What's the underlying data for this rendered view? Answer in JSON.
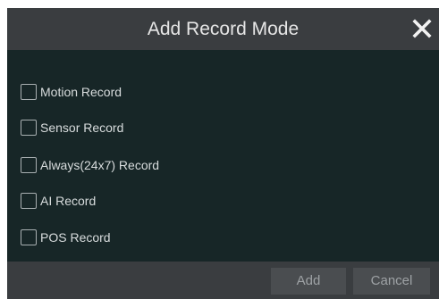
{
  "dialog": {
    "title": "Add Record Mode",
    "close_icon": "close-icon",
    "options": [
      {
        "label": "Motion Record",
        "checked": false
      },
      {
        "label": "Sensor Record",
        "checked": false
      },
      {
        "label": "Always(24x7) Record",
        "checked": false
      },
      {
        "label": "AI Record",
        "checked": false
      },
      {
        "label": "POS Record",
        "checked": false
      }
    ],
    "buttons": {
      "add_label": "Add",
      "cancel_label": "Cancel"
    }
  },
  "colors": {
    "titlebar": "#3a3d40",
    "body": "#172627",
    "text": "#d8dcdd",
    "button": "#4a4d50"
  }
}
